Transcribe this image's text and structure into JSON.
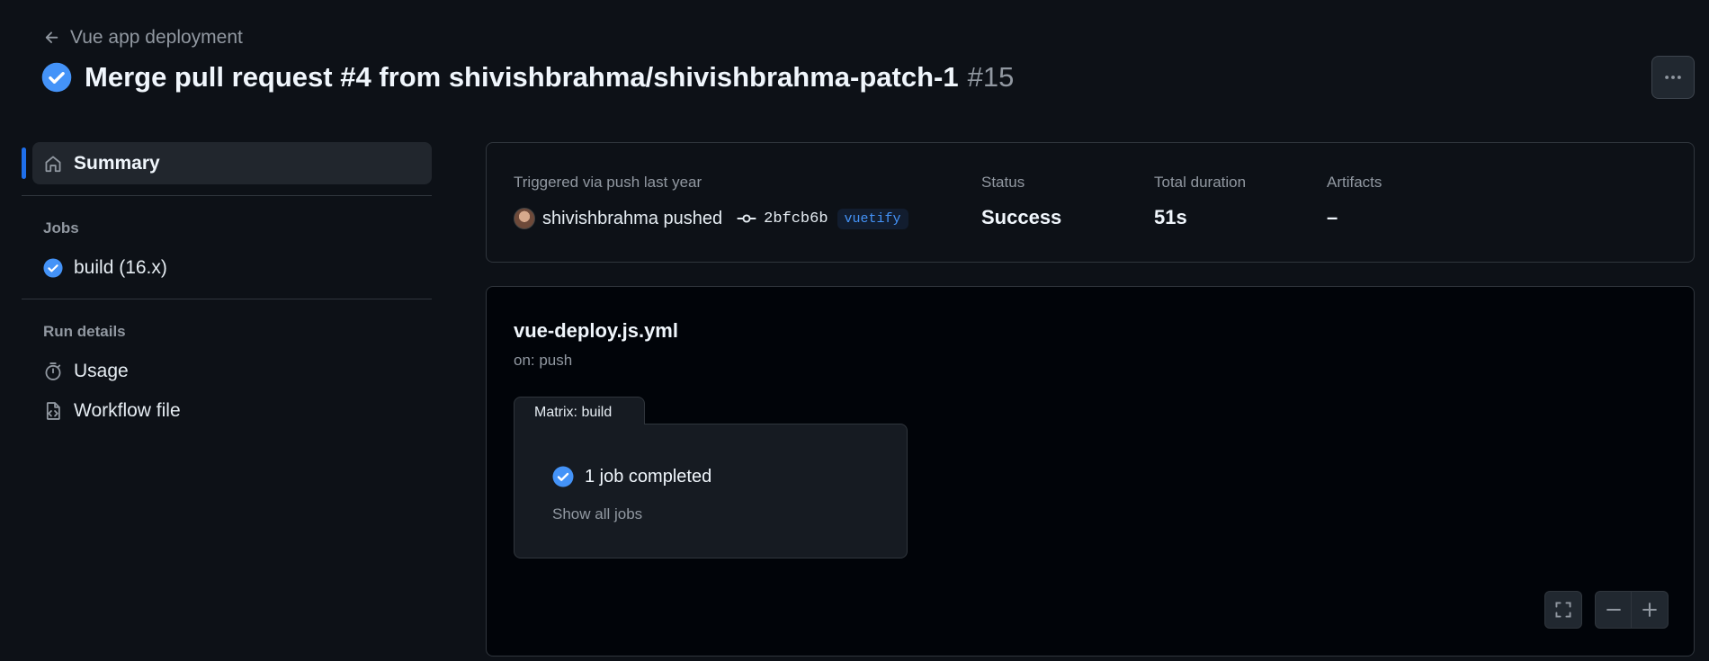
{
  "header": {
    "back_label": "Vue app deployment",
    "title": "Merge pull request #4 from shivishbrahma/shivishbrahma-patch-1",
    "run_number": "#15"
  },
  "sidebar": {
    "summary_label": "Summary",
    "jobs_heading": "Jobs",
    "jobs": [
      {
        "label": "build (16.x)",
        "status": "success"
      }
    ],
    "run_details_heading": "Run details",
    "run_details": [
      {
        "label": "Usage",
        "icon": "stopwatch-icon"
      },
      {
        "label": "Workflow file",
        "icon": "file-code-icon"
      }
    ]
  },
  "summary": {
    "trigger_label": "Triggered via push last year",
    "actor": "shivishbrahma pushed",
    "commit_sha": "2bfcb6b",
    "branch": "vuetify",
    "status_label": "Status",
    "status_value": "Success",
    "duration_label": "Total duration",
    "duration_value": "51s",
    "artifacts_label": "Artifacts",
    "artifacts_value": "–"
  },
  "workflow": {
    "file_name": "vue-deploy.js.yml",
    "trigger": "on: push",
    "matrix_label": "Matrix: build",
    "job_summary": "1 job completed",
    "show_all": "Show all jobs"
  },
  "colors": {
    "background": "#0d1117",
    "success": "#4493f8",
    "accent": "#1f6feb",
    "muted_text": "#9198a1"
  }
}
